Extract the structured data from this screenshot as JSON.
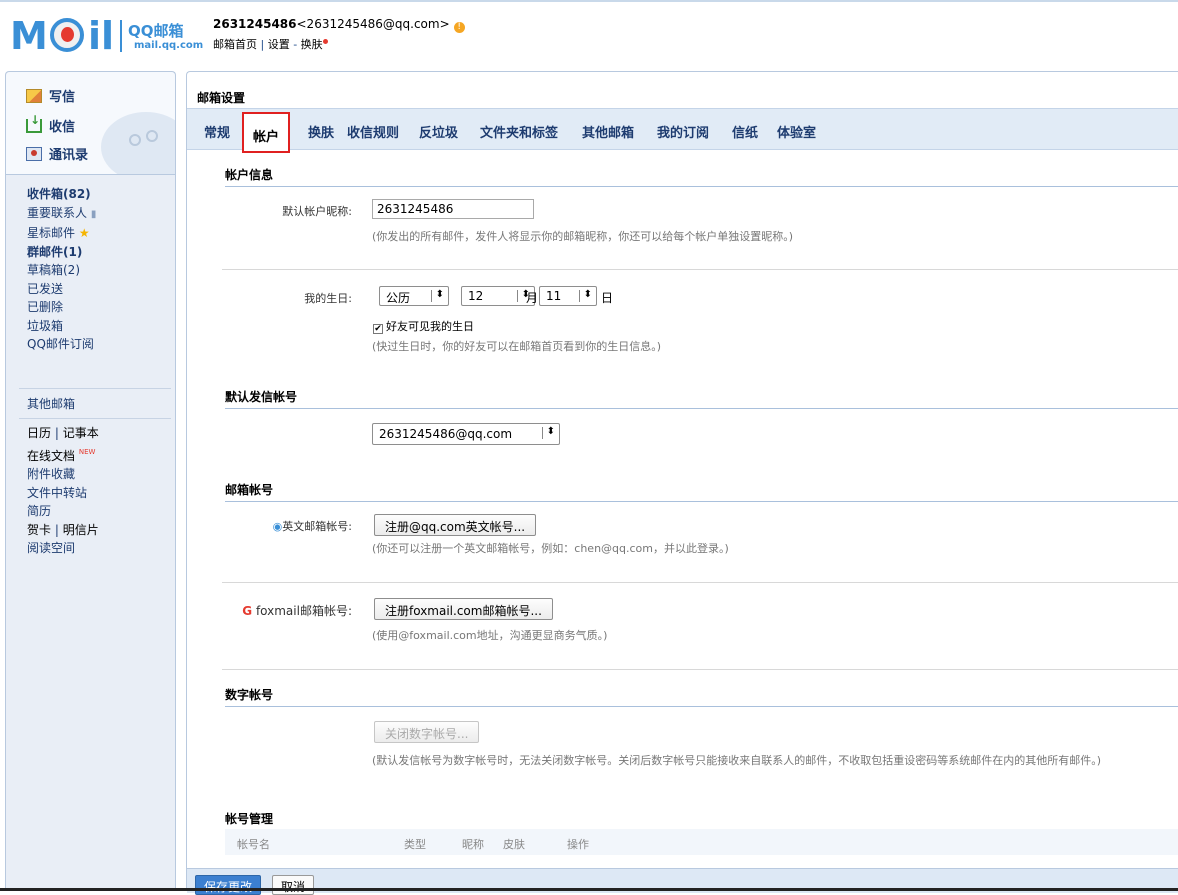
{
  "header": {
    "logo_text": "M",
    "logo_il": "il",
    "logo_brand": "QQ邮箱",
    "logo_domain": "mail.qq.com",
    "account_id": "2631245486",
    "account_email": "<2631245486@qq.com>",
    "links": [
      "邮箱首页",
      "设置",
      "换肤"
    ]
  },
  "sidebar": {
    "write": "写信",
    "receive": "收信",
    "contacts": "通讯录",
    "folders": [
      {
        "label": "收件箱(82)",
        "bold": true
      },
      {
        "label": "重要联系人",
        "bold": false
      },
      {
        "label": "星标邮件",
        "bold": false
      },
      {
        "label": "群邮件(1)",
        "bold": true
      },
      {
        "label": "草稿箱(2)",
        "bold": false
      },
      {
        "label": "已发送",
        "bold": false
      },
      {
        "label": "已删除",
        "bold": false
      },
      {
        "label": "垃圾箱",
        "bold": false
      },
      {
        "label": "QQ邮件订阅",
        "bold": false
      }
    ],
    "other_mail": "其他邮箱",
    "tools": {
      "calendar": "日历",
      "notes": "记事本",
      "docs": "在线文档",
      "docs_badge": "NEW",
      "attachments": "附件收藏",
      "transfer": "文件中转站",
      "resume": "简历",
      "card": "贺卡",
      "postcard": "明信片",
      "reading": "阅读空间"
    }
  },
  "main": {
    "title": "邮箱设置",
    "tabs": [
      "常规",
      "帐户",
      "换肤",
      "收信规则",
      "反垃圾",
      "文件夹和标签",
      "其他邮箱",
      "我的订阅",
      "信纸",
      "体验室"
    ],
    "active_tab": "帐户",
    "account_info": {
      "section": "帐户信息",
      "nickname_label": "默认帐户昵称:",
      "nickname_value": "2631245486",
      "nickname_hint": "(你发出的所有邮件，发件人将显示你的邮箱昵称，你还可以给每个帐户单独设置昵称。)",
      "birthday_label": "我的生日:",
      "calendar_type": "公历",
      "month": "12",
      "month_unit": "月",
      "day": "11",
      "day_unit": "日",
      "birthday_visible": "好友可见我的生日",
      "birthday_hint": "(快过生日时，你的好友可以在邮箱首页看到你的生日信息。)"
    },
    "default_sender": {
      "section": "默认发信帐号",
      "value": "2631245486@qq.com"
    },
    "mail_accounts": {
      "section": "邮箱帐号",
      "english_label": "英文邮箱帐号:",
      "english_button": "注册@qq.com英文帐号...",
      "english_hint": "(你还可以注册一个英文邮箱帐号，例如：chen@qq.com，并以此登录。)",
      "foxmail_label": "foxmail邮箱帐号:",
      "foxmail_button": "注册foxmail.com邮箱帐号...",
      "foxmail_hint": "(使用@foxmail.com地址，沟通更显商务气质。)"
    },
    "numeric_account": {
      "section": "数字帐号",
      "button": "关闭数字帐号...",
      "hint": "(默认发信帐号为数字帐号时，无法关闭数字帐号。关闭后数字帐号只能接收来自联系人的邮件，不收取包括重设密码等系统邮件在内的其他所有邮件。)"
    },
    "account_mgmt": {
      "section": "帐号管理",
      "columns": [
        "帐号名",
        "类型",
        "昵称",
        "皮肤",
        "操作"
      ]
    },
    "save": "保存更改",
    "cancel": "取消"
  },
  "colors": {
    "accent": "#3a8fd6",
    "tab_bar": "#e1ebf6",
    "highlight_box": "#e02020"
  }
}
